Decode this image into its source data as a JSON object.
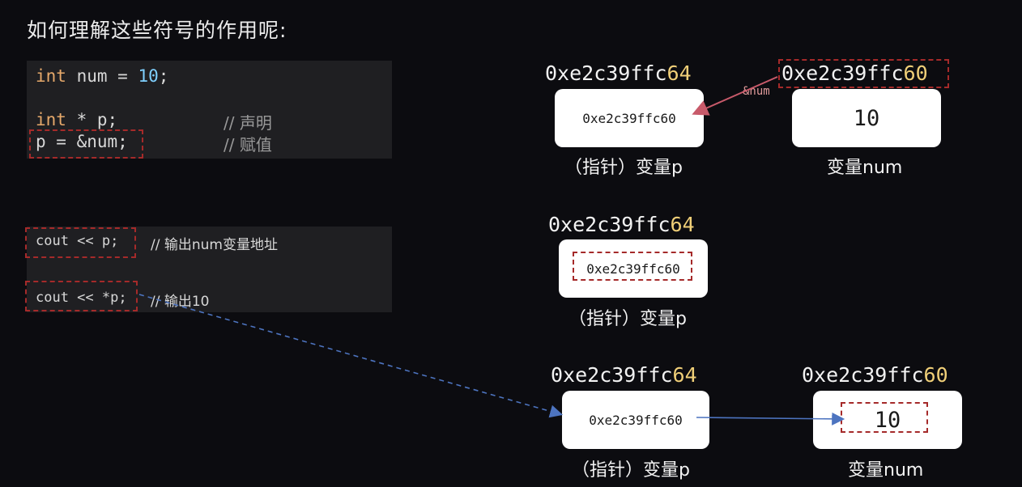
{
  "title": "如何理解这些符号的作用呢:",
  "code_block_1": {
    "line1": {
      "kw": "int",
      "rest": " num = ",
      "num": "10",
      "end": ";"
    },
    "line2": {
      "kw": "int",
      "rest": " * p;",
      "comment": "// 声明"
    },
    "line3": {
      "code": "p = &num;",
      "comment": "// 赋值"
    }
  },
  "code_block_2": {
    "line1": {
      "code": "cout << p;",
      "comment": "// 输出num变量地址"
    },
    "line2": {
      "code": "cout << *p;",
      "comment": "// 输出10"
    }
  },
  "diagram1": {
    "p_addr_head": "0xe2c39ffc",
    "p_addr_tail": "64",
    "num_addr_head": "0xe2c39ffc",
    "num_addr_tail": "60",
    "p_value": "0xe2c39ffc60",
    "num_value": "10",
    "arrow_label": "&num",
    "p_caption": "（指针）变量p",
    "num_caption": "变量num"
  },
  "diagram2": {
    "p_addr_head": "0xe2c39ffc",
    "p_addr_tail": "64",
    "p_value": "0xe2c39ffc60",
    "p_caption": "（指针）变量p"
  },
  "diagram3": {
    "p_addr_head": "0xe2c39ffc",
    "p_addr_tail": "64",
    "num_addr_head": "0xe2c39ffc",
    "num_addr_tail": "60",
    "p_value": "0xe2c39ffc60",
    "num_value": "10",
    "p_caption": "（指针）变量p",
    "num_caption": "变量num"
  },
  "colors": {
    "highlight_dash": "#a52a2a",
    "keyword": "#e6a96b",
    "number": "#7fd0ff",
    "addr_tail": "#f0cf78",
    "arrow_red": "#c85a6a",
    "arrow_blue": "#4d74c0"
  }
}
